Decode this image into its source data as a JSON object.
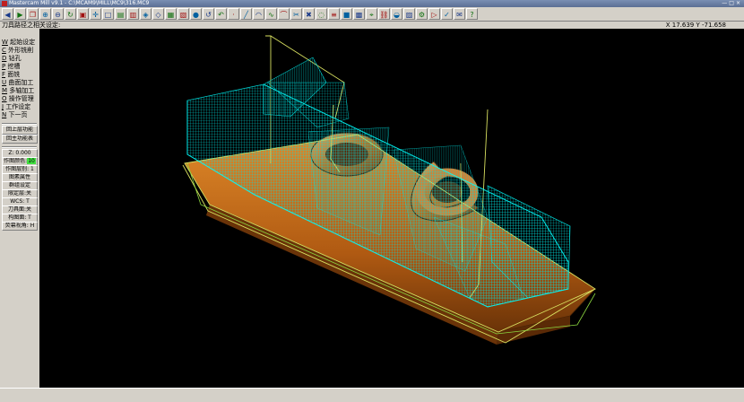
{
  "window": {
    "title": "Mastercam Mill v9.1 - C:\\MCAM9\\MILL\\MC9\\316.MC9"
  },
  "toolbar": {
    "icons": [
      "back-arrow",
      "forward-arrow",
      "zoom-window",
      "zoom-in",
      "zoom-out",
      "redraw",
      "fit",
      "pan",
      "gview-top",
      "gview-front",
      "gview-side",
      "gview-iso",
      "gview-normal",
      "cplane",
      "tplane",
      "shade",
      "rotate",
      "undo",
      "point",
      "line",
      "arc",
      "spline",
      "fillet",
      "trim",
      "delete",
      "hide",
      "level",
      "color",
      "mask",
      "analyze",
      "chain",
      "surface",
      "solid",
      "toolpath",
      "backplot",
      "verify",
      "post",
      "help"
    ]
  },
  "status": {
    "prompt": "刀具路径之相关设定:",
    "coords": "X 17.639  Y -71.658"
  },
  "menu": {
    "items": [
      {
        "hk": "W",
        "label": "起始设定"
      },
      {
        "hk": "C",
        "label": "外形铣削"
      },
      {
        "hk": "D",
        "label": "钻孔"
      },
      {
        "hk": "P",
        "label": "挖槽"
      },
      {
        "hk": "F",
        "label": "面铣"
      },
      {
        "hk": "U",
        "label": "曲面加工"
      },
      {
        "hk": "M",
        "label": "多轴加工"
      },
      {
        "hk": "O",
        "label": "操作管理"
      },
      {
        "hk": "J",
        "label": "工作设定"
      },
      {
        "hk": "N",
        "label": "下一页"
      }
    ],
    "back_label": "回上层功能",
    "main_label": "回主功能表",
    "params": {
      "z": "Z: 0.000",
      "color_label": "作图颜色:",
      "color_value": "10",
      "level": "作图层别: 1",
      "attrib": "图素属性",
      "mask": "群组设定",
      "limit": "限定层:关",
      "wcs": "WCS: T",
      "tplane": "刀具面:关",
      "cplane": "构图面: T",
      "gview": "荧幕视角: H"
    }
  },
  "colors": {
    "viewport_bg": "#000000",
    "stock": "#00e5e5",
    "part": "#c06a18",
    "boundary": "#d8e060"
  }
}
